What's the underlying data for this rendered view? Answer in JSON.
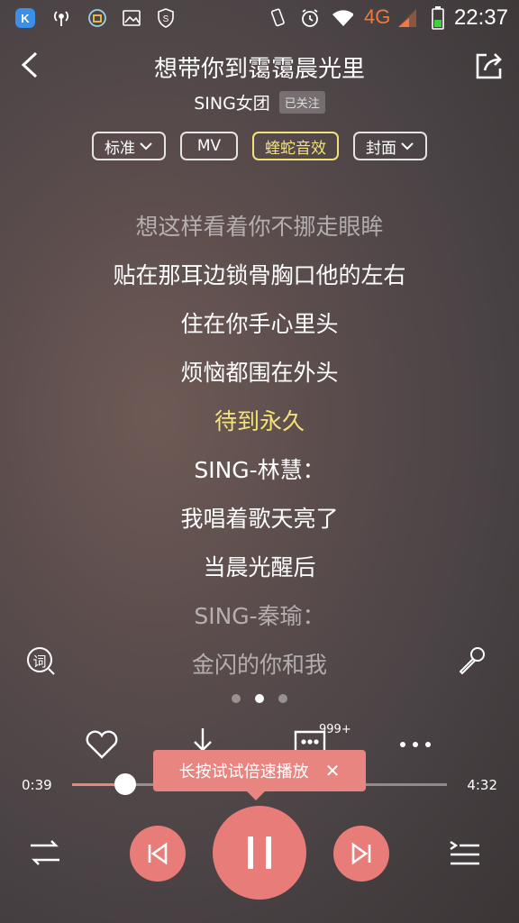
{
  "status_bar": {
    "time": "22:37",
    "network": "4G"
  },
  "header": {
    "title": "想带你到霭霭晨光里",
    "artist": "SING女团",
    "follow_label": "已关注"
  },
  "options": [
    {
      "label": "标准",
      "dropdown": true,
      "active": false
    },
    {
      "label": "MV",
      "dropdown": false,
      "active": false
    },
    {
      "label": "蝰蛇音效",
      "dropdown": false,
      "active": true
    },
    {
      "label": "封面",
      "dropdown": true,
      "active": false
    }
  ],
  "lyrics": [
    {
      "text": "想这样看着你不挪走眼眸",
      "state": "dim"
    },
    {
      "text": "贴在那耳边锁骨胸口他的左右",
      "state": "normal"
    },
    {
      "text": "住在你手心里头",
      "state": "normal"
    },
    {
      "text": "烦恼都围在外头",
      "state": "normal"
    },
    {
      "text": "待到永久",
      "state": "current"
    },
    {
      "text": "SING-林慧：",
      "state": "normal"
    },
    {
      "text": "我唱着歌天亮了",
      "state": "normal"
    },
    {
      "text": "当晨光醒后",
      "state": "normal"
    },
    {
      "text": "SING-秦瑜：",
      "state": "dim"
    },
    {
      "text": "金闪的你和我",
      "state": "dim"
    }
  ],
  "lyric_icon_label": "词",
  "pager": {
    "pages": 3,
    "active": 1
  },
  "comment_count": "999+",
  "tooltip": {
    "text": "长按试试倍速播放",
    "close": "✕"
  },
  "progress": {
    "elapsed": "0:39",
    "total": "4:32",
    "fraction": 0.143
  },
  "colors": {
    "accent": "#e87c78",
    "highlight": "#f3e27a"
  }
}
